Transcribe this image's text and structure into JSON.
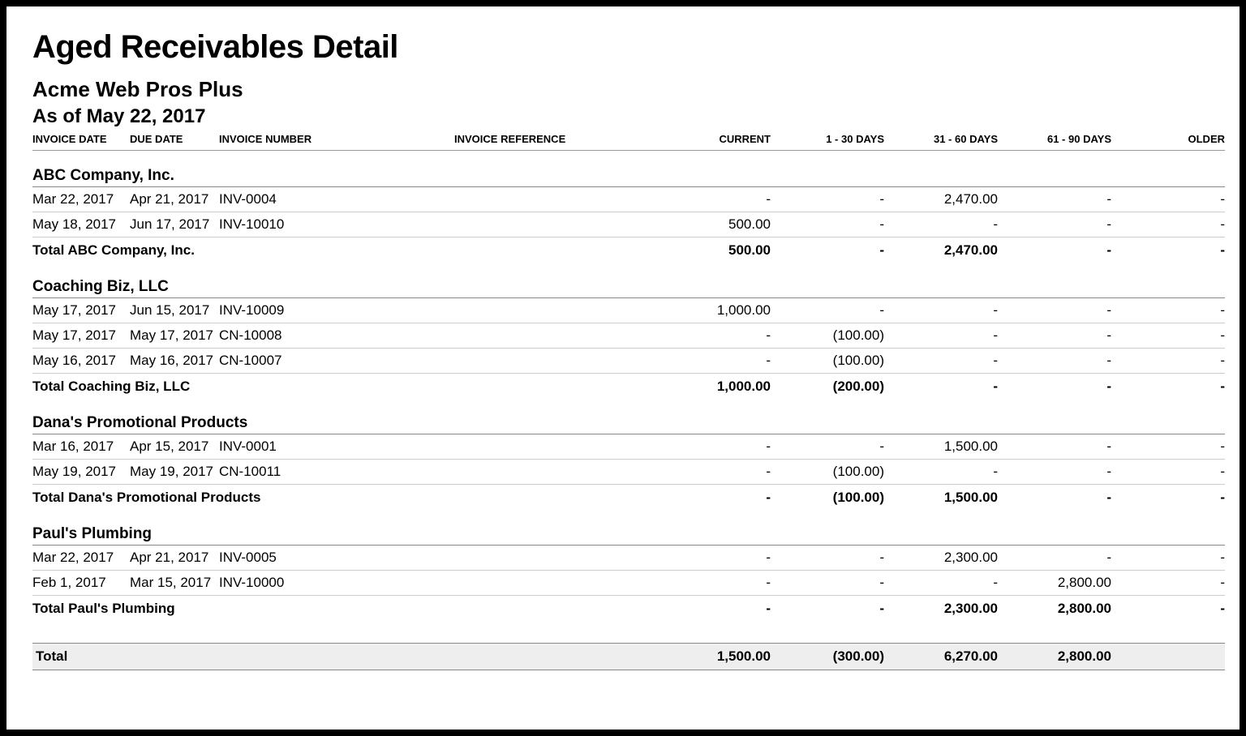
{
  "title": "Aged Receivables Detail",
  "company": "Acme Web Pros Plus",
  "asof": "As of May 22, 2017",
  "headers": {
    "invoice_date": "INVOICE DATE",
    "due_date": "DUE DATE",
    "invoice_number": "INVOICE NUMBER",
    "invoice_reference": "INVOICE REFERENCE",
    "current": "CURRENT",
    "d1_30": "1 - 30 DAYS",
    "d31_60": "31 - 60 DAYS",
    "d61_90": "61 - 90 DAYS",
    "older": "OLDER"
  },
  "groups": [
    {
      "name": "ABC Company, Inc.",
      "rows": [
        {
          "inv_date": "Mar 22, 2017",
          "due_date": "Apr 21, 2017",
          "inv_num": "INV-0004",
          "ref": "",
          "current": "-",
          "d1_30": "-",
          "d31_60": "2,470.00",
          "d61_90": "-",
          "older": "-"
        },
        {
          "inv_date": "May 18, 2017",
          "due_date": "Jun 17, 2017",
          "inv_num": "INV-10010",
          "ref": "",
          "current": "500.00",
          "d1_30": "-",
          "d31_60": "-",
          "d61_90": "-",
          "older": "-"
        }
      ],
      "total_label": "Total ABC Company, Inc.",
      "total": {
        "current": "500.00",
        "d1_30": "-",
        "d31_60": "2,470.00",
        "d61_90": "-",
        "older": "-"
      }
    },
    {
      "name": "Coaching Biz, LLC",
      "rows": [
        {
          "inv_date": "May 17, 2017",
          "due_date": "Jun 15, 2017",
          "inv_num": "INV-10009",
          "ref": "",
          "current": "1,000.00",
          "d1_30": "-",
          "d31_60": "-",
          "d61_90": "-",
          "older": "-"
        },
        {
          "inv_date": "May 17, 2017",
          "due_date": "May 17, 2017",
          "inv_num": "CN-10008",
          "ref": "",
          "current": "-",
          "d1_30": "(100.00)",
          "d31_60": "-",
          "d61_90": "-",
          "older": "-"
        },
        {
          "inv_date": "May 16, 2017",
          "due_date": "May 16, 2017",
          "inv_num": "CN-10007",
          "ref": "",
          "current": "-",
          "d1_30": "(100.00)",
          "d31_60": "-",
          "d61_90": "-",
          "older": "-"
        }
      ],
      "total_label": "Total Coaching Biz, LLC",
      "total": {
        "current": "1,000.00",
        "d1_30": "(200.00)",
        "d31_60": "-",
        "d61_90": "-",
        "older": "-"
      }
    },
    {
      "name": "Dana's Promotional Products",
      "rows": [
        {
          "inv_date": "Mar 16, 2017",
          "due_date": "Apr 15, 2017",
          "inv_num": "INV-0001",
          "ref": "",
          "current": "-",
          "d1_30": "-",
          "d31_60": "1,500.00",
          "d61_90": "-",
          "older": "-"
        },
        {
          "inv_date": "May 19, 2017",
          "due_date": "May 19, 2017",
          "inv_num": "CN-10011",
          "ref": "",
          "current": "-",
          "d1_30": "(100.00)",
          "d31_60": "-",
          "d61_90": "-",
          "older": "-"
        }
      ],
      "total_label": "Total Dana's Promotional Products",
      "total": {
        "current": "-",
        "d1_30": "(100.00)",
        "d31_60": "1,500.00",
        "d61_90": "-",
        "older": "-"
      }
    },
    {
      "name": "Paul's Plumbing",
      "rows": [
        {
          "inv_date": "Mar 22, 2017",
          "due_date": "Apr 21, 2017",
          "inv_num": "INV-0005",
          "ref": "",
          "current": "-",
          "d1_30": "-",
          "d31_60": "2,300.00",
          "d61_90": "-",
          "older": "-"
        },
        {
          "inv_date": "Feb 1, 2017",
          "due_date": "Mar 15, 2017",
          "inv_num": "INV-10000",
          "ref": "",
          "current": "-",
          "d1_30": "-",
          "d31_60": "-",
          "d61_90": "2,800.00",
          "older": "-"
        }
      ],
      "total_label": "Total Paul's Plumbing",
      "total": {
        "current": "-",
        "d1_30": "-",
        "d31_60": "2,300.00",
        "d61_90": "2,800.00",
        "older": "-"
      }
    }
  ],
  "grand_label": "Total",
  "grand": {
    "current": "1,500.00",
    "d1_30": "(300.00)",
    "d31_60": "6,270.00",
    "d61_90": "2,800.00",
    "older": ""
  }
}
